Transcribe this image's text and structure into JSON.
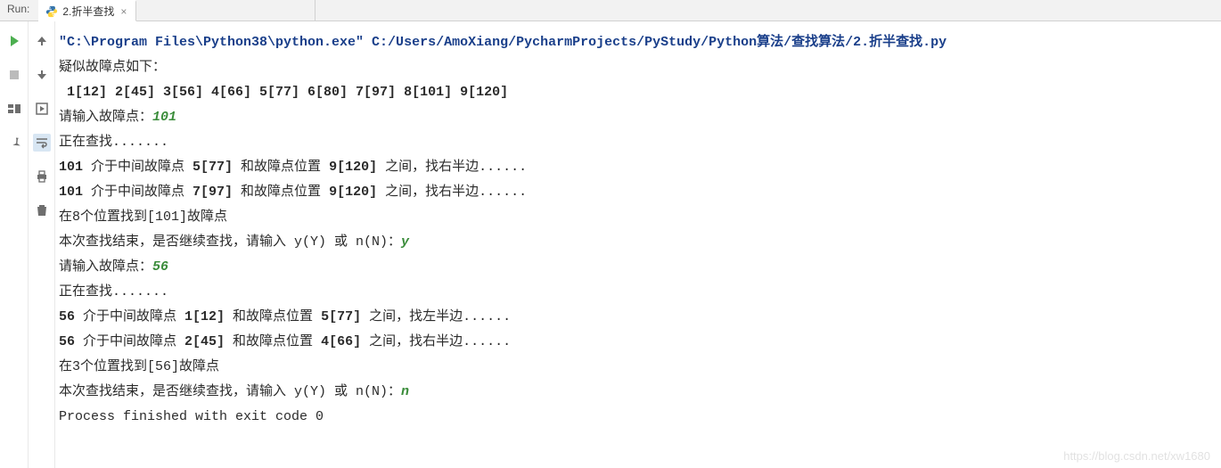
{
  "run_label": "Run:",
  "tab": {
    "icon": "python-file-icon",
    "title": "2.折半查找",
    "close": "×"
  },
  "toolbar_left": {
    "run": "run-icon",
    "stop": "stop-icon",
    "layout": "layout-icon",
    "pin": "pin-icon"
  },
  "toolbar_mid": {
    "up": "arrow-up-icon",
    "down": "arrow-down-icon",
    "restart": "restart-icon",
    "wrap": "wrap-icon",
    "print": "print-icon",
    "trash": "trash-icon"
  },
  "console": {
    "command": "\"C:\\Program Files\\Python38\\python.exe\" C:/Users/AmoXiang/PycharmProjects/PyStudy/Python算法/查找算法/2.折半查找.py",
    "lines": [
      {
        "text": "疑似故障点如下：",
        "bold": false
      },
      {
        "text": " 1[12] 2[45] 3[56] 4[66] 5[77] 6[80] 7[97] 8[101] 9[120]",
        "bold": true
      },
      {
        "prefix": "请输入故障点：",
        "input": "101"
      },
      {
        "text": "正在查找......."
      },
      {
        "segments": [
          "101",
          " 介于中间故障点 ",
          "5[77]",
          " 和故障点位置 ",
          "9[120]",
          " 之间，找右半边......"
        ],
        "bold_idx": [
          0,
          2,
          4
        ]
      },
      {
        "segments": [
          "101",
          " 介于中间故障点 ",
          "7[97]",
          " 和故障点位置 ",
          "9[120]",
          " 之间，找右半边......"
        ],
        "bold_idx": [
          0,
          2,
          4
        ]
      },
      {
        "text": "在8个位置找到[101]故障点"
      },
      {
        "prefix": "本次查找结束，是否继续查找，请输入 y(Y) 或 n(N)：",
        "input": "y"
      },
      {
        "prefix": "请输入故障点：",
        "input": "56"
      },
      {
        "text": "正在查找......."
      },
      {
        "segments": [
          "56",
          " 介于中间故障点 ",
          "1[12]",
          " 和故障点位置 ",
          "5[77]",
          " 之间，找左半边......"
        ],
        "bold_idx": [
          0,
          2,
          4
        ]
      },
      {
        "segments": [
          "56",
          " 介于中间故障点 ",
          "2[45]",
          " 和故障点位置 ",
          "4[66]",
          " 之间，找右半边......"
        ],
        "bold_idx": [
          0,
          2,
          4
        ]
      },
      {
        "text": "在3个位置找到[56]故障点"
      },
      {
        "prefix": "本次查找结束，是否继续查找，请输入 y(Y) 或 n(N)：",
        "input": "n"
      },
      {
        "text": ""
      },
      {
        "text": "Process finished with exit code 0"
      }
    ]
  },
  "watermark": "https://blog.csdn.net/xw1680"
}
